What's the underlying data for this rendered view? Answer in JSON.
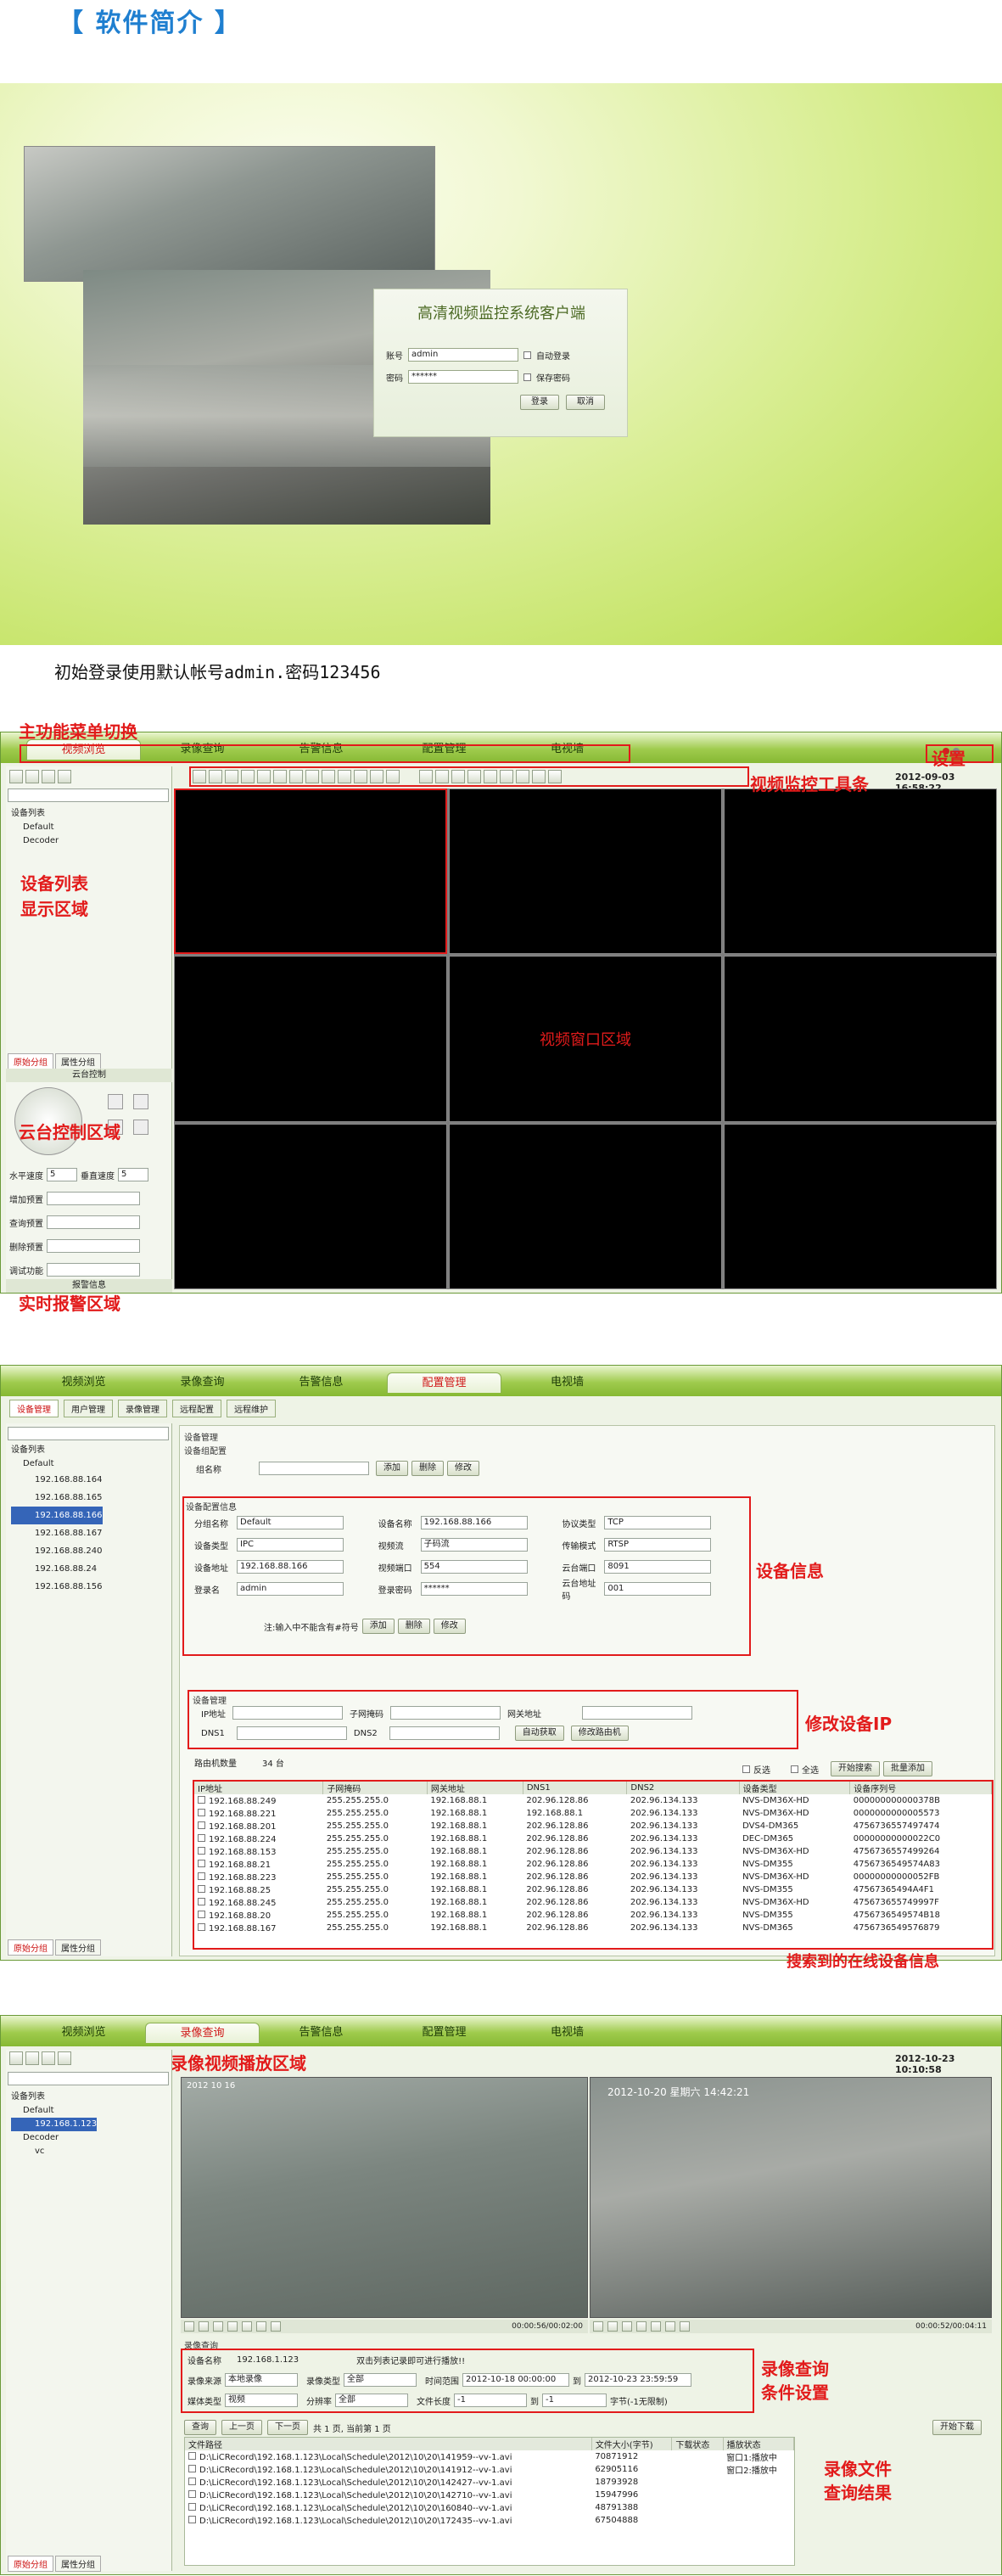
{
  "header": {
    "title": "【 软件简介 】"
  },
  "login": {
    "title": "高清视频监控系统客户端",
    "account_label": "账号",
    "account_value": "admin",
    "password_label": "密码",
    "password_value": "******",
    "auto_login": "自动登录",
    "save_password": "保存密码",
    "login_btn": "登录",
    "cancel_btn": "取消"
  },
  "caption": "初始登录使用默认帐号admin.密码123456",
  "tabs": [
    "视频浏览",
    "录像查询",
    "告警信息",
    "配置管理",
    "电视墙"
  ],
  "s1": {
    "ann_menu": "主功能菜单切换",
    "ann_settings": "设置",
    "ann_toolbar": "视频监控工具条",
    "ann_devlist": "设备列表\n显示区域",
    "ann_video": "视频窗口区域",
    "ann_ptz": "云台控制区域",
    "ann_alarm": "实时报警区域",
    "datetime": "2012-09-03 16:58:22",
    "tree": [
      "设备列表",
      "Default",
      "Decoder"
    ],
    "tab_basic": "原始分组",
    "tab_attr": "属性分组",
    "ptz_title": "云台控制",
    "h_speed": "水平速度",
    "v_speed": "垂直速度",
    "speed_val": "5",
    "add_preset": "增加预置",
    "query_preset": "查询预置",
    "del_preset": "删除预置",
    "aux": "调试功能",
    "alarm_info": "报警信息"
  },
  "s2": {
    "subtabs": [
      "设备管理",
      "用户管理",
      "录像管理",
      "远程配置",
      "远程维护"
    ],
    "tree": [
      "设备列表",
      "Default",
      "192.168.88.164",
      "192.168.88.165",
      "192.168.88.166",
      "192.168.88.167",
      "192.168.88.240",
      "192.168.88.24",
      "192.168.88.156"
    ],
    "dev_mgmt": "设备管理",
    "dev_group": "设备组配置",
    "group_name": "组名称",
    "add": "添加",
    "del": "删除",
    "mod": "修改",
    "dev_cfg": "设备配置信息",
    "cfg": {
      "group_label": "分组名称",
      "group_val": "Default",
      "devname_label": "设备名称",
      "devname_val": "192.168.88.166",
      "proto_label": "协议类型",
      "proto_val": "TCP",
      "devtype_label": "设备类型",
      "devtype_val": "IPC",
      "stream_label": "视频流",
      "stream_val": "子码流",
      "trans_label": "传输模式",
      "trans_val": "RTSP",
      "addr_label": "设备地址",
      "addr_val": "192.168.88.166",
      "vport_label": "视频端口",
      "vport_val": "554",
      "pport_label": "云台端口",
      "pport_val": "8091",
      "user_label": "登录名",
      "user_val": "admin",
      "pwd_label": "登录密码",
      "pwd_val": "******",
      "paddr_label": "云台地址码",
      "paddr_val": "001"
    },
    "note": "注:输入中不能含有#符号",
    "ann_devinfo": "设备信息",
    "ann_modip": "修改设备IP",
    "ann_online": "搜索到的在线设备信息",
    "net": {
      "title": "设备管理",
      "ip": "IP地址",
      "mask": "子网掩码",
      "gw": "网关地址",
      "dns1": "DNS1",
      "dns2": "DNS2",
      "auto": "自动获取",
      "modify": "修改路由机"
    },
    "count_label": "路由机数量",
    "count_val": "34 台",
    "invert": "反选",
    "all": "全选",
    "start_search": "开始搜索",
    "batch_add": "批量添加",
    "cols": [
      "IP地址",
      "子网掩码",
      "网关地址",
      "DNS1",
      "DNS2",
      "设备类型",
      "设备序列号"
    ],
    "rows": [
      [
        "192.168.88.249",
        "255.255.255.0",
        "192.168.88.1",
        "202.96.128.86",
        "202.96.134.133",
        "NVS-DM36X-HD",
        "000000000000378B"
      ],
      [
        "192.168.88.221",
        "255.255.255.0",
        "192.168.88.1",
        "192.168.88.1",
        "202.96.134.133",
        "NVS-DM36X-HD",
        "0000000000005573"
      ],
      [
        "192.168.88.201",
        "255.255.255.0",
        "192.168.88.1",
        "202.96.128.86",
        "202.96.134.133",
        "DVS4-DM365",
        "4756736557497474"
      ],
      [
        "192.168.88.224",
        "255.255.255.0",
        "192.168.88.1",
        "202.96.128.86",
        "202.96.134.133",
        "DEC-DM365",
        "00000000000022C0"
      ],
      [
        "192.168.88.153",
        "255.255.255.0",
        "192.168.88.1",
        "202.96.128.86",
        "202.96.134.133",
        "NVS-DM36X-HD",
        "4756736557499264"
      ],
      [
        "192.168.88.21",
        "255.255.255.0",
        "192.168.88.1",
        "202.96.128.86",
        "202.96.134.133",
        "NVS-DM355",
        "4756736549574A83"
      ],
      [
        "192.168.88.223",
        "255.255.255.0",
        "192.168.88.1",
        "202.96.128.86",
        "202.96.134.133",
        "NVS-DM36X-HD",
        "00000000000052FB"
      ],
      [
        "192.168.88.25",
        "255.255.255.0",
        "192.168.88.1",
        "202.96.128.86",
        "202.96.134.133",
        "NVS-DM355",
        "47567365494A4F1"
      ],
      [
        "192.168.88.245",
        "255.255.255.0",
        "192.168.88.1",
        "202.96.128.86",
        "202.96.134.133",
        "NVS-DM36X-HD",
        "475673655749997F"
      ],
      [
        "192.168.88.20",
        "255.255.255.0",
        "192.168.88.1",
        "202.96.128.86",
        "202.96.134.133",
        "NVS-DM355",
        "4756736549574B18"
      ],
      [
        "192.168.88.167",
        "255.255.255.0",
        "192.168.88.1",
        "202.96.128.86",
        "202.96.134.133",
        "NVS-DM365",
        "4756736549576879"
      ]
    ]
  },
  "s3": {
    "datetime": "2012-10-23 10:10:58",
    "ann_play": "录像视频播放区域",
    "ann_query": "录像查询\n条件设置",
    "ann_result": "录像文件\n查询结果",
    "tree": [
      "设备列表",
      "Default",
      "192.168.1.123",
      "Decoder",
      "vc"
    ],
    "cam1_ts": "2012 10 16",
    "cam2_ts": "2012-10-20 星期六 14:42:21",
    "time1": "00:00:56/00:02:00",
    "time2": "00:00:52/00:04:11",
    "q": {
      "title": "录像查询",
      "devname_label": "设备名称",
      "devname_val": "192.168.1.123",
      "hint": "双击列表记录即可进行播放!!",
      "src_label": "录像来源",
      "src_val": "本地录像",
      "rtype_label": "录像类型",
      "rtype_val": "全部",
      "range_label": "时间范围",
      "from_date": "2012-10-18",
      "from_time": "00:00:00",
      "to_label": "到",
      "to_date": "2012-10-23",
      "to_time": "23:59:59",
      "media_label": "媒体类型",
      "media_val": "视频",
      "res_label": "分辨率",
      "res_val": "全部",
      "len_label": "文件长度",
      "len_from": "-1",
      "len_to_label": "到",
      "len_to": "-1",
      "unit": "字节(-1无限制)"
    },
    "query_btn": "查询",
    "prev": "上一页",
    "next": "下一页",
    "pageinfo": "共 1 页, 当前第 1 页",
    "start_dl": "开始下载",
    "cols": [
      "文件路径",
      "文件大小(字节)",
      "下载状态",
      "播放状态"
    ],
    "files": [
      [
        "D:\\LiCRecord\\192.168.1.123\\Local\\Schedule\\2012\\10\\20\\141959--vv-1.avi",
        "70871912",
        "",
        "窗口1:播放中"
      ],
      [
        "D:\\LiCRecord\\192.168.1.123\\Local\\Schedule\\2012\\10\\20\\141912--vv-1.avi",
        "62905116",
        "",
        "窗口2:播放中"
      ],
      [
        "D:\\LiCRecord\\192.168.1.123\\Local\\Schedule\\2012\\10\\20\\142427--vv-1.avi",
        "18793928",
        "",
        ""
      ],
      [
        "D:\\LiCRecord\\192.168.1.123\\Local\\Schedule\\2012\\10\\20\\142710--vv-1.avi",
        "15947996",
        "",
        ""
      ],
      [
        "D:\\LiCRecord\\192.168.1.123\\Local\\Schedule\\2012\\10\\20\\160840--vv-1.avi",
        "48791388",
        "",
        ""
      ],
      [
        "D:\\LiCRecord\\192.168.1.123\\Local\\Schedule\\2012\\10\\20\\172435--vv-1.avi",
        "67504888",
        "",
        ""
      ]
    ]
  }
}
